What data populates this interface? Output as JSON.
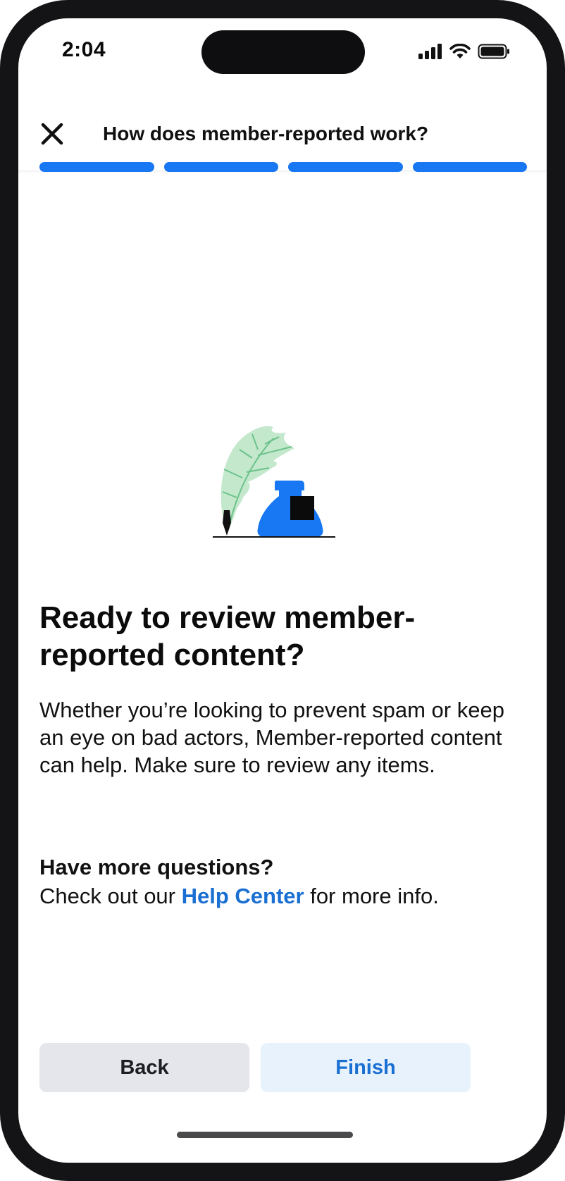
{
  "status_bar": {
    "time": "2:04"
  },
  "header": {
    "title": "How does member-reported work?"
  },
  "progress": {
    "steps_total": 4,
    "steps_completed": 4
  },
  "content": {
    "title": "Ready to review member-reported content?",
    "body": "Whether you’re looking to prevent spam or keep an eye on bad actors, Member-reported content can help. Make sure to review any items.",
    "questions_title": "Have more questions?",
    "questions_prefix": "Check out our ",
    "help_link": "Help Center",
    "questions_suffix": " for more info."
  },
  "buttons": {
    "back": "Back",
    "finish": "Finish"
  },
  "colors": {
    "accent": "#1877f2",
    "link": "#1a6fd3",
    "secondary_button": "#e4e6eb",
    "primary_button_bg": "#e7f2fd"
  },
  "icons": [
    "close-icon",
    "cellular-signal-icon",
    "wifi-icon",
    "battery-icon",
    "quill-inkwell-illustration"
  ]
}
